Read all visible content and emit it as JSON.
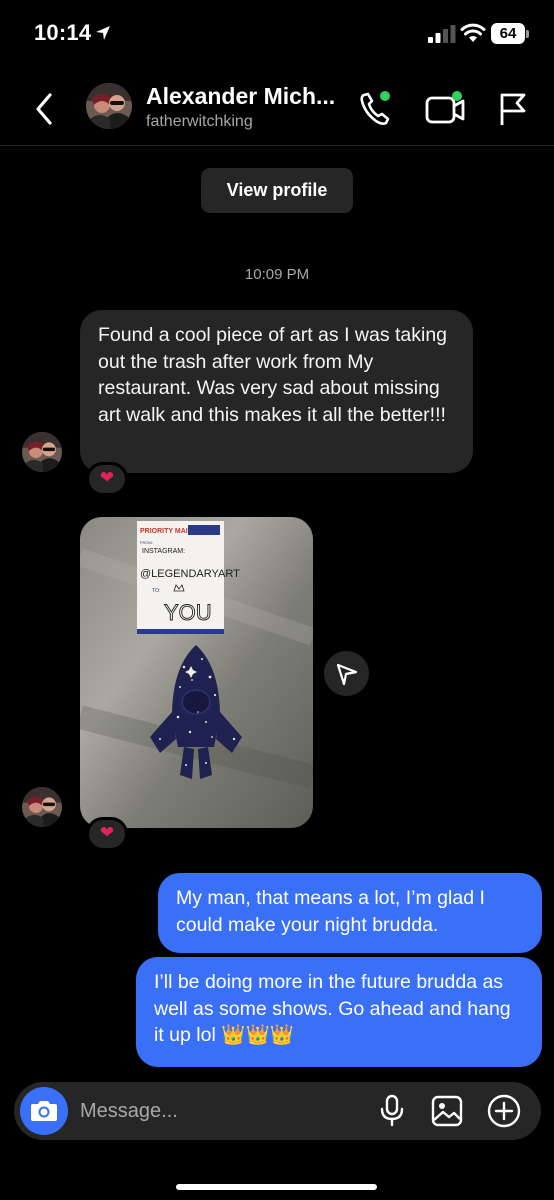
{
  "status_bar": {
    "time": "10:14",
    "battery": "64"
  },
  "header": {
    "name": "Alexander Mich...",
    "username": "fatherwitchking"
  },
  "chat": {
    "view_profile_label": "View profile",
    "timestamp": "10:09 PM",
    "messages": [
      {
        "direction": "incoming",
        "text": "Found a cool piece of art as I was taking out the trash after work from My restaurant. Was very sad about missing art walk and this makes it all the better!!!",
        "reaction": "❤"
      },
      {
        "direction": "incoming",
        "type": "photo",
        "reaction": "❤",
        "photo_text": {
          "label_header": "PRIORITY MAIL",
          "from": "FROM:",
          "instagram": "INSTAGRAM:",
          "handle": "@LEGENDARYART",
          "to": "TO:",
          "you": "YOU"
        }
      },
      {
        "direction": "outgoing",
        "text": "My man, that means a lot, I’m glad I could make your night brudda."
      },
      {
        "direction": "outgoing",
        "text": "I’ll be doing more in the future brudda as well as some shows. Go ahead and hang it up lol 👑👑👑"
      }
    ]
  },
  "composer": {
    "placeholder": "Message..."
  },
  "colors": {
    "background": "#000000",
    "incoming_bubble": "#262626",
    "outgoing_bubble": "#3a6ff7",
    "online": "#35d05b",
    "reaction_heart": "#e0245e"
  },
  "icons": [
    "location-arrow-icon",
    "signal-icon",
    "wifi-icon",
    "back-chevron-icon",
    "phone-icon",
    "video-camera-icon",
    "flag-icon",
    "send-icon",
    "camera-icon",
    "microphone-icon",
    "gallery-icon",
    "plus-icon",
    "heart-icon"
  ]
}
